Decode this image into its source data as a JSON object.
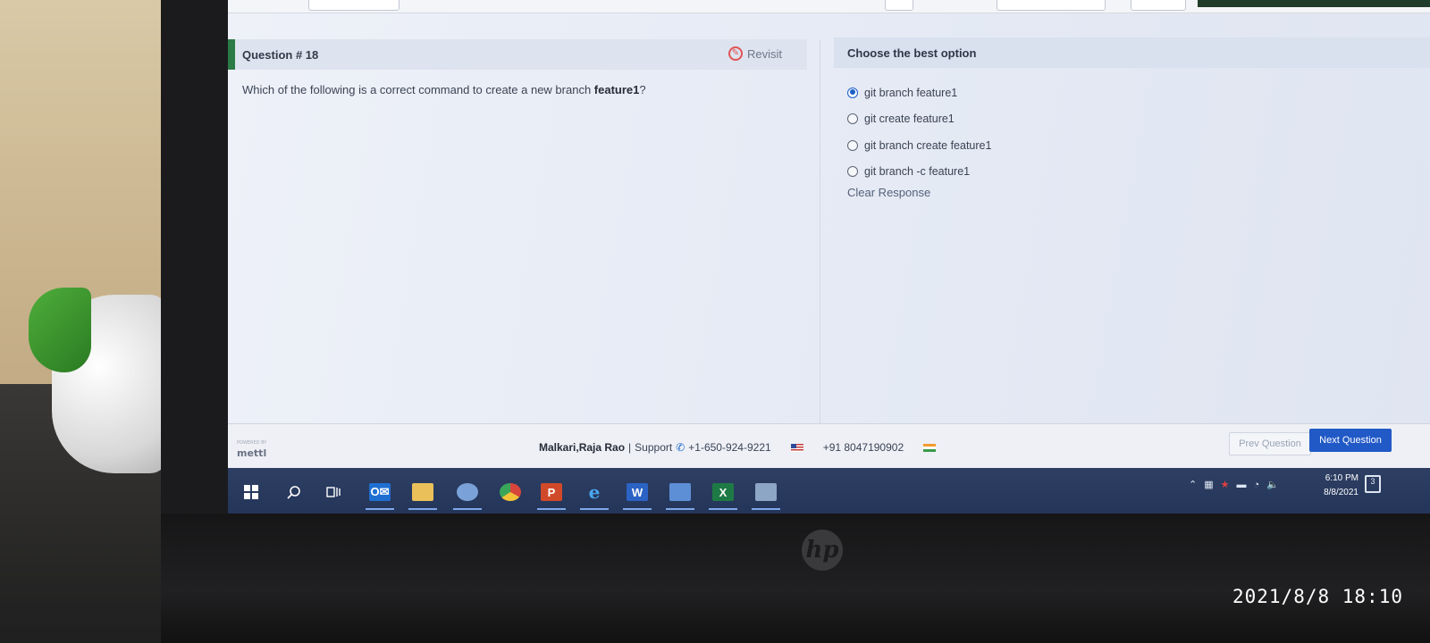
{
  "question": {
    "header": "Question # 18",
    "revisit_label": "Revisit",
    "text_prefix": "Which of the following is a correct command to create a new branch ",
    "text_bold": "feature1",
    "text_suffix": "?"
  },
  "answers": {
    "header": "Choose the best option",
    "options": [
      {
        "label": "git branch feature1",
        "selected": true
      },
      {
        "label": "git create feature1",
        "selected": false
      },
      {
        "label": "git branch create feature1",
        "selected": false
      },
      {
        "label": "git branch -c feature1",
        "selected": false
      }
    ],
    "clear_label": "Clear Response"
  },
  "footer": {
    "logo": "mettl",
    "candidate_name": "Malkari,Raja Rao",
    "separator": "|",
    "support_label": "Support",
    "phone_us": "+1-650-924-9221",
    "phone_in": "+91 8047190902",
    "prev_label": "Prev Question",
    "next_label": "Next Question"
  },
  "taskbar": {
    "time": "6:10 PM",
    "date": "8/8/2021",
    "notification_count": "3",
    "apps": [
      "windows-start",
      "search",
      "task-view",
      "outlook",
      "file-explorer",
      "app-blue",
      "chrome",
      "powerpoint",
      "edge",
      "word",
      "app-notes",
      "excel",
      "app-generic"
    ]
  },
  "photo_timestamp": "2021/8/8 18:10",
  "colors": {
    "accent_green": "#2c7a45",
    "next_button": "#2159c6",
    "selected_radio": "#1a5fc7",
    "taskbar": "#24355a"
  }
}
